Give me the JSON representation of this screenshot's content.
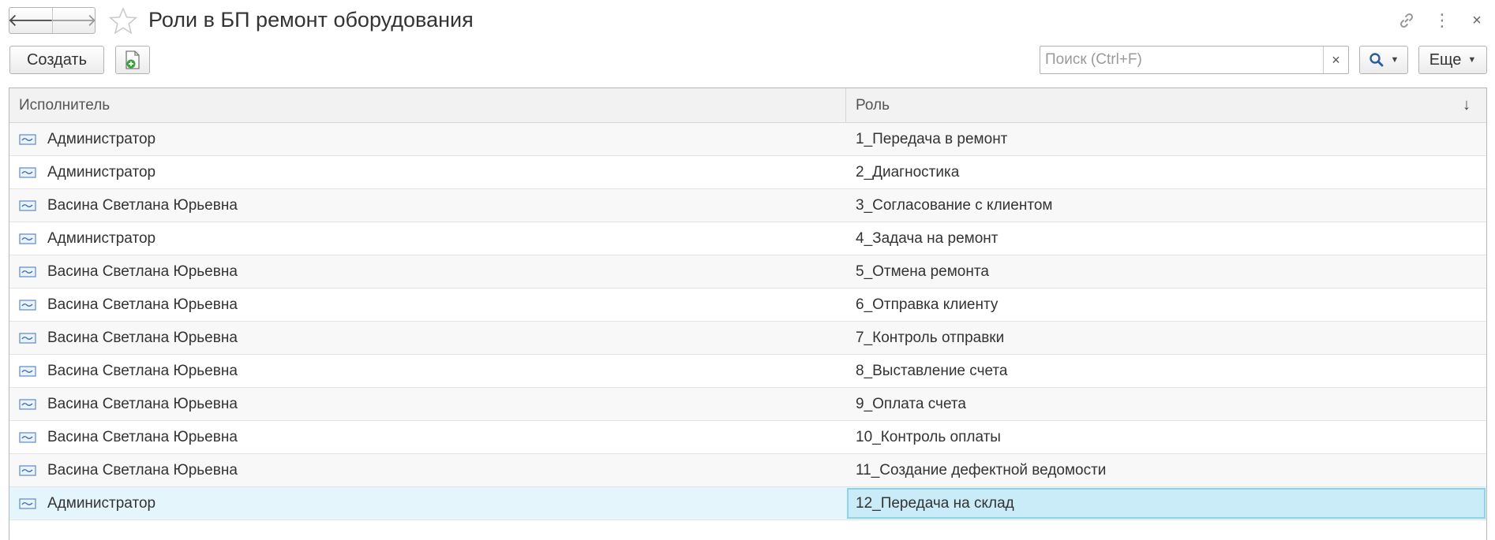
{
  "window": {
    "title": "Роли в БП ремонт оборудования",
    "back_glyph": "🡐",
    "forward_glyph": "🡒",
    "link_glyph": "🔗",
    "more_glyph": "⋮",
    "close_glyph": "×"
  },
  "toolbar": {
    "create_label": "Создать",
    "search_placeholder": "Поиск (Ctrl+F)",
    "search_clear_glyph": "×",
    "more_label": "Еще",
    "caret_glyph": "▼"
  },
  "table": {
    "columns": {
      "performer": "Исполнитель",
      "role": "Роль",
      "sort_glyph": "↓"
    },
    "rows": [
      {
        "performer": "Администратор",
        "role": "1_Передача в ремонт"
      },
      {
        "performer": "Администратор",
        "role": "2_Диагностика"
      },
      {
        "performer": "Васина Светлана Юрьевна",
        "role": "3_Согласование с клиентом"
      },
      {
        "performer": "Администратор",
        "role": "4_Задача на ремонт"
      },
      {
        "performer": "Васина Светлана Юрьевна",
        "role": "5_Отмена ремонта"
      },
      {
        "performer": "Васина Светлана Юрьевна",
        "role": "6_Отправка клиенту"
      },
      {
        "performer": "Васина Светлана Юрьевна",
        "role": "7_Контроль отправки"
      },
      {
        "performer": "Васина Светлана Юрьевна",
        "role": "8_Выставление счета"
      },
      {
        "performer": "Васина Светлана Юрьевна",
        "role": "9_Оплата счета"
      },
      {
        "performer": "Васина Светлана Юрьевна",
        "role": "10_Контроль оплаты"
      },
      {
        "performer": "Васина Светлана Юрьевна",
        "role": "11_Создание дефектной ведомости"
      },
      {
        "performer": "Администратор",
        "role": "12_Передача на склад"
      }
    ],
    "selected_row": 11
  },
  "colors": {
    "selected_row": "#e4f5fb",
    "selected_cell": "#c9ecf8",
    "header_bg": "#f2f2f2",
    "star": "#c8c8c8",
    "add_icon_green": "#3aa33a"
  }
}
